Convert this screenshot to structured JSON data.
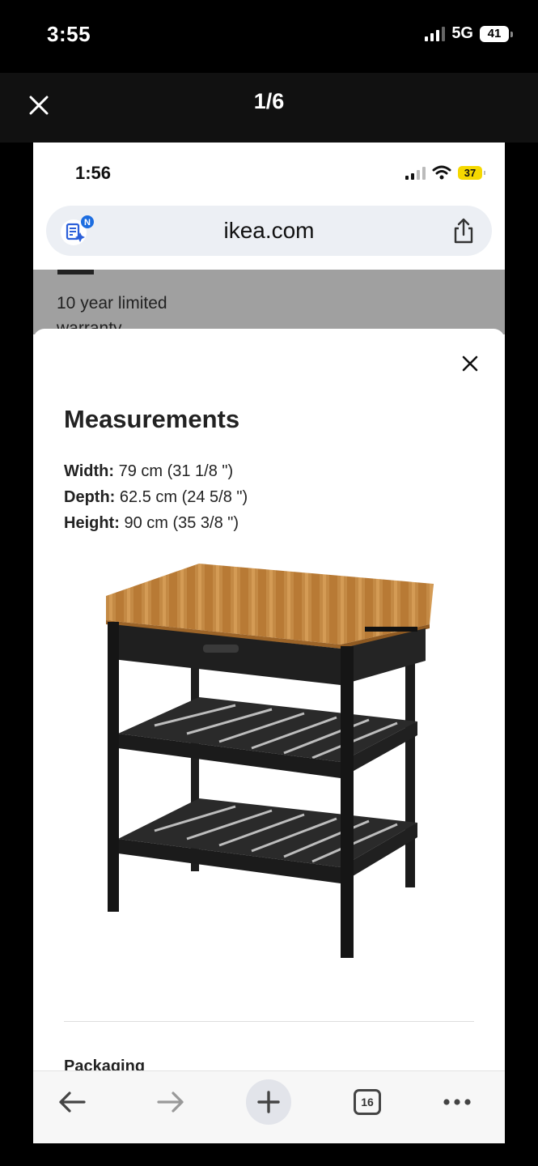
{
  "outer": {
    "status_time": "3:55",
    "network": "5G",
    "battery": "41",
    "counter": "1/6"
  },
  "inner": {
    "status_time": "1:56",
    "battery": "37",
    "url": "ikea.com"
  },
  "background_page": {
    "warranty": "10 year limited warranty"
  },
  "sheet": {
    "title": "Measurements",
    "specs": [
      {
        "label": "Width:",
        "value": "79 cm (31 1/8 \")"
      },
      {
        "label": "Depth:",
        "value": "62.5 cm (24 5/8 \")"
      },
      {
        "label": "Height:",
        "value": "90 cm (35 3/8 \")"
      }
    ],
    "peek_text": "Packaging"
  },
  "toolbar": {
    "tab_count": "16"
  },
  "colors": {
    "outer_bg": "#000000",
    "header_bg": "#111111",
    "url_bar_bg": "#eceff4",
    "battery_inner": "#f5d800",
    "overlay_gray": "#a0a0a0"
  }
}
